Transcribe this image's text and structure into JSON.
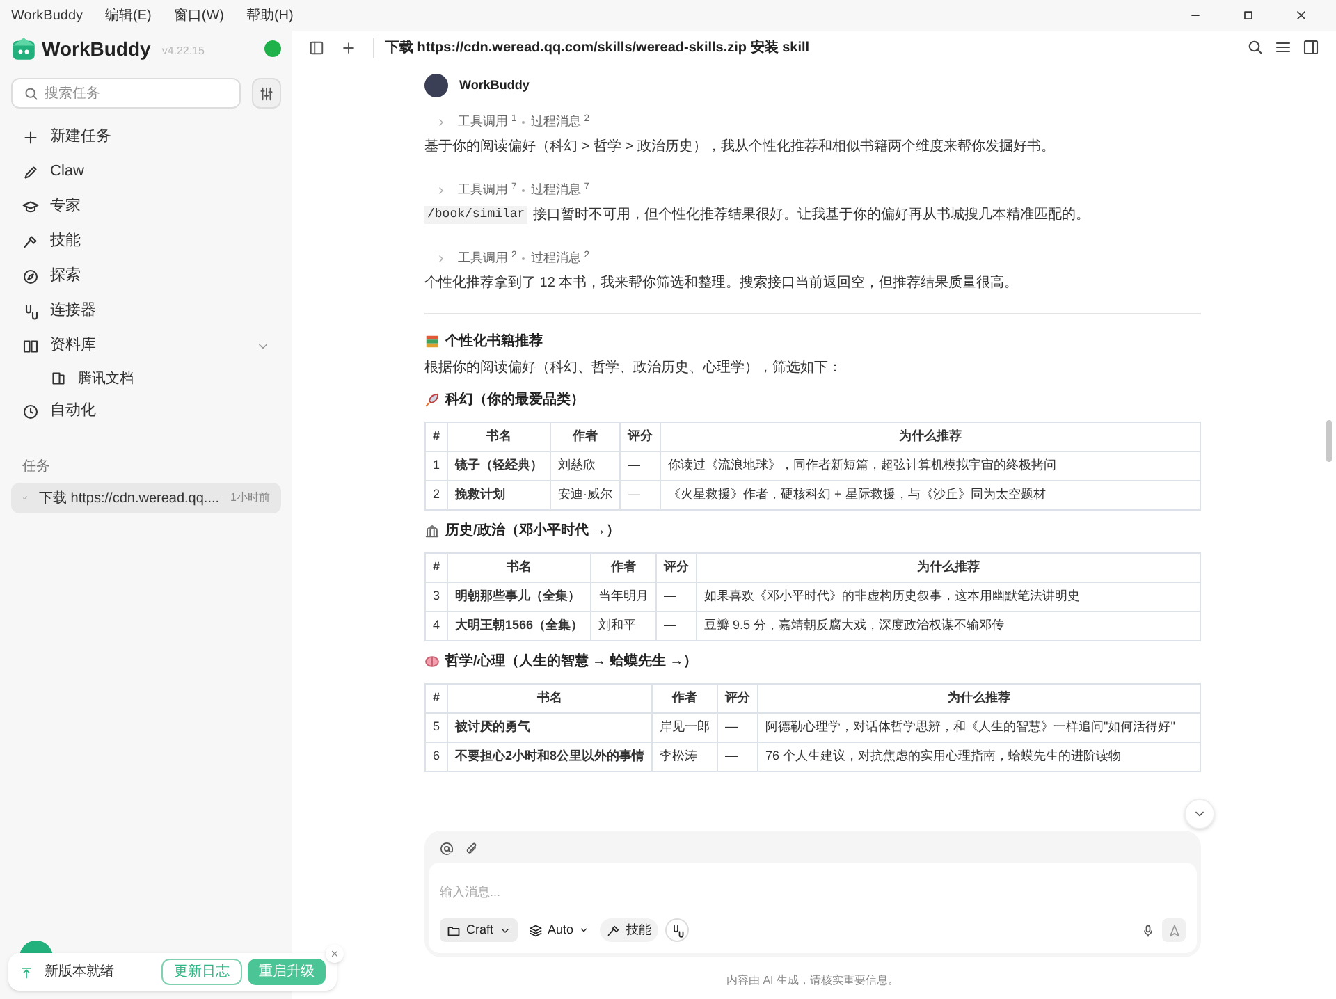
{
  "menu_bar": [
    "WorkBuddy",
    "编辑(E)",
    "窗口(W)",
    "帮助(H)"
  ],
  "brand": {
    "name": "WorkBuddy",
    "version": "v4.22.15"
  },
  "search": {
    "placeholder": "搜索任务"
  },
  "nav": [
    {
      "label": "新建任务"
    },
    {
      "label": "Claw"
    },
    {
      "label": "专家"
    },
    {
      "label": "技能"
    },
    {
      "label": "探索"
    },
    {
      "label": "连接器"
    },
    {
      "label": "资料库",
      "expanded": true,
      "children": [
        {
          "label": "腾讯文档"
        }
      ]
    },
    {
      "label": "自动化"
    }
  ],
  "tasks": {
    "title": "任务",
    "items": [
      {
        "title": "下载 https://cdn.weread.qq....",
        "time": "1小时前",
        "selected": true,
        "done": true
      }
    ]
  },
  "update_toast": {
    "text": "新版本就绪",
    "buttons": [
      "更新日志",
      "重启升级"
    ]
  },
  "header": {
    "title": "下载 https://cdn.weread.qq.com/skills/weread-skills.zip 安装 skill"
  },
  "chat": {
    "sender": "WorkBuddy",
    "steps": [
      {
        "tool_label": "工具调用",
        "tool_count": "1",
        "msg_label": "过程消息",
        "msg_count": "2",
        "text": "基于你的阅读偏好（科幻 > 哲学 > 政治历史），我从个性化推荐和相似书籍两个维度来帮你发掘好书。"
      },
      {
        "tool_label": "工具调用",
        "tool_count": "7",
        "msg_label": "过程消息",
        "msg_count": "7",
        "code": "/book/similar",
        "text": "接口暂时不可用，但个性化推荐结果很好。让我基于你的偏好再从书城搜几本精准匹配的。"
      },
      {
        "tool_label": "工具调用",
        "tool_count": "2",
        "msg_label": "过程消息",
        "msg_count": "2",
        "text": "个性化推荐拿到了 12 本书，我来帮你筛选和整理。搜索接口当前返回空，但推荐结果质量很高。"
      }
    ],
    "heading": "个性化书籍推荐",
    "intro": "根据你的阅读偏好（科幻、哲学、政治历史、心理学），筛选如下：",
    "groups": [
      {
        "title": "科幻（你的最爱品类）",
        "columns": [
          "#",
          "书名",
          "作者",
          "评分",
          "为什么推荐"
        ],
        "rows": [
          [
            "1",
            "镜子（轻经典）",
            "刘慈欣",
            "—",
            "你读过《流浪地球》，同作者新短篇，超弦计算机模拟宇宙的终极拷问"
          ],
          [
            "2",
            "挽救计划",
            "安迪·威尔",
            "—",
            "《火星救援》作者，硬核科幻 + 星际救援，与《沙丘》同为太空题材"
          ]
        ]
      },
      {
        "title": "历史/政治（邓小平时代 →）",
        "columns": [
          "#",
          "书名",
          "作者",
          "评分",
          "为什么推荐"
        ],
        "rows": [
          [
            "3",
            "明朝那些事儿（全集）",
            "当年明月",
            "—",
            "如果喜欢《邓小平时代》的非虚构历史叙事，这本用幽默笔法讲明史"
          ],
          [
            "4",
            "大明王朝1566（全集）",
            "刘和平",
            "—",
            "豆瓣 9.5 分，嘉靖朝反腐大戏，深度政治权谋不输邓传"
          ]
        ]
      },
      {
        "title": "哲学/心理（人生的智慧 → 蛤蟆先生 →）",
        "columns": [
          "#",
          "书名",
          "作者",
          "评分",
          "为什么推荐"
        ],
        "rows": [
          [
            "5",
            "被讨厌的勇气",
            "岸见一郎",
            "—",
            "阿德勒心理学，对话体哲学思辨，和《人生的智慧》一样追问\"如何活得好\""
          ],
          [
            "6",
            "不要担心2小时和8公里以外的事情",
            "李松涛",
            "—",
            "76 个人生建议，对抗焦虑的实用心理指南，蛤蟆先生的进阶读物"
          ]
        ]
      }
    ]
  },
  "composer": {
    "placeholder": "输入消息...",
    "mode": "Craft",
    "model": "Auto",
    "skill": "技能"
  },
  "footer_note": "内容由 AI 生成，请核实重要信息。"
}
